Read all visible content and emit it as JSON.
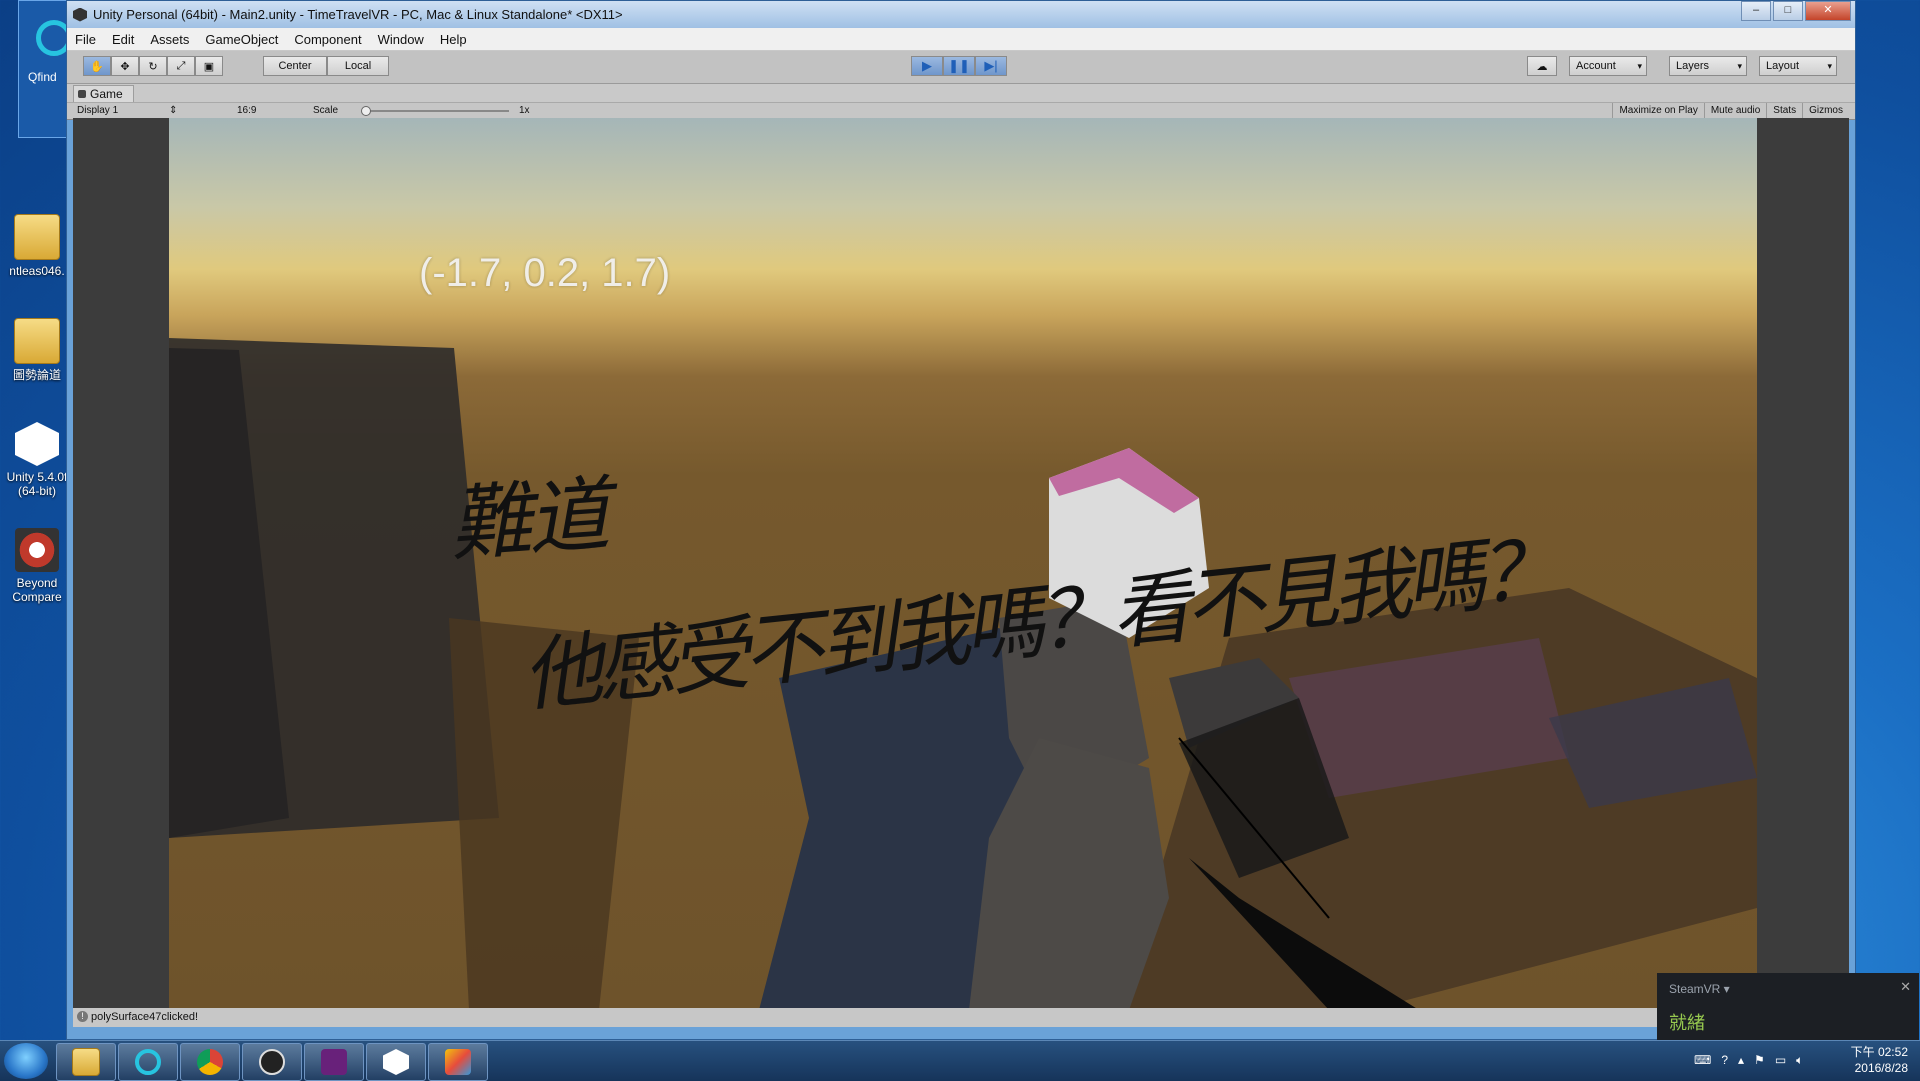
{
  "desktop": {
    "icons": [
      {
        "label": "Qfind"
      },
      {
        "label": "ntleas046."
      },
      {
        "label": "圖勢論道"
      },
      {
        "label": "Unity 5.4.0f (64-bit)"
      },
      {
        "label": "Beyond Compare"
      }
    ]
  },
  "window": {
    "title": "Unity Personal (64bit) - Main2.unity - TimeTravelVR - PC, Mac & Linux Standalone* <DX11>",
    "menu": [
      "File",
      "Edit",
      "Assets",
      "GameObject",
      "Component",
      "Window",
      "Help"
    ],
    "toolbar": {
      "pivot": "Center",
      "space": "Local",
      "account": "Account",
      "layers": "Layers",
      "layout": "Layout"
    },
    "game_panel": {
      "tab": "Game",
      "display": "Display 1",
      "aspect": "16:9",
      "scale_label": "Scale",
      "scale_value": "1x",
      "maximize": "Maximize on Play",
      "mute": "Mute audio",
      "stats": "Stats",
      "gizmos": "Gizmos"
    },
    "scene": {
      "coordinates": "(-1.7, 0.2, 1.7)",
      "handwriting_line1": "難道",
      "handwriting_line2": "他感受不到我嗎？看不見我嗎？"
    },
    "status": "polySurface47clicked!"
  },
  "steamvr": {
    "title": "SteamVR ▾",
    "status": "就緒"
  },
  "taskbar": {
    "time": "下午 02:52",
    "date": "2016/8/28"
  },
  "colors": {
    "play_active": "#6f96cb",
    "steamvr_status": "#96c84f"
  }
}
